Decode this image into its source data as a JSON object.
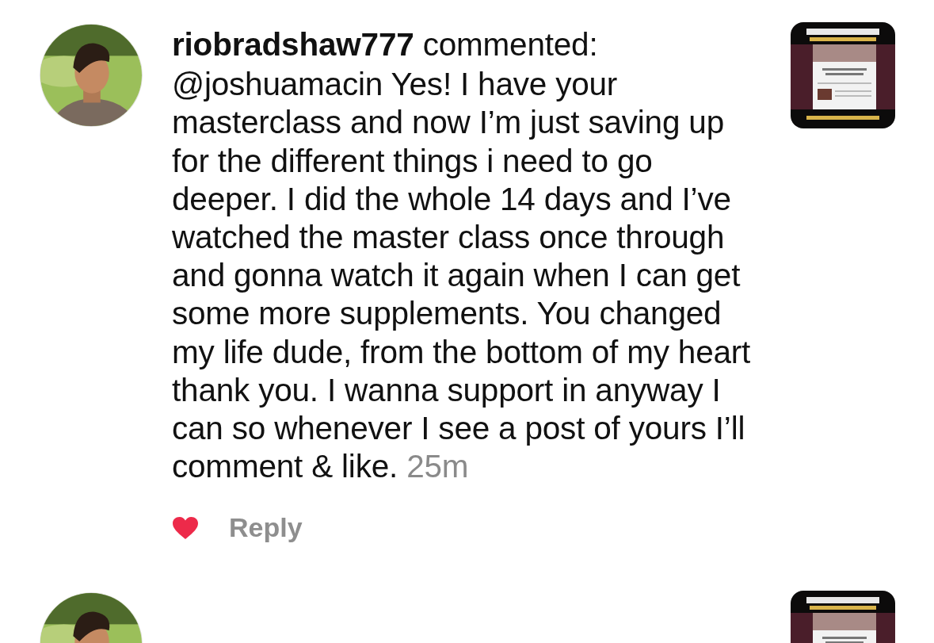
{
  "comment": {
    "username": "riobradshaw777",
    "action": "commented:",
    "text": "@joshuamacin Yes! I have your masterclass and now I’m just saving up for the different things i need to go deeper. I did the whole 14 days and I’ve watched the master class once through and gonna watch it again when I can get some more supplements. You changed my life dude, from the bottom of my heart thank you. I wanna support in anyway I can so whenever I see a post of yours I’ll comment & like.",
    "time": "25m",
    "liked": true,
    "reply_label": "Reply"
  }
}
